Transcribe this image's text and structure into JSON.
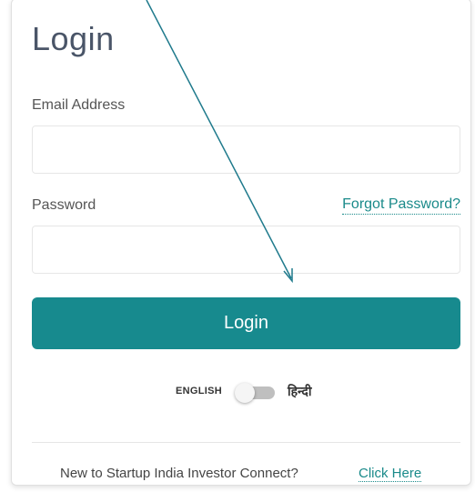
{
  "login": {
    "title": "Login",
    "email_label": "Email Address",
    "email_value": "",
    "password_label": "Password",
    "password_value": "",
    "forgot_password": "Forgot Password?",
    "submit_label": "Login"
  },
  "language": {
    "english_label": "ENGLISH",
    "hindi_label": "हिन्दी",
    "selected": "ENGLISH"
  },
  "footer": {
    "prompt": "New to Startup India Investor Connect?",
    "link": "Click Here"
  },
  "colors": {
    "accent": "#178a8e",
    "link": "#1a8a8a",
    "annotation_arrow": "#1f7a8c"
  }
}
